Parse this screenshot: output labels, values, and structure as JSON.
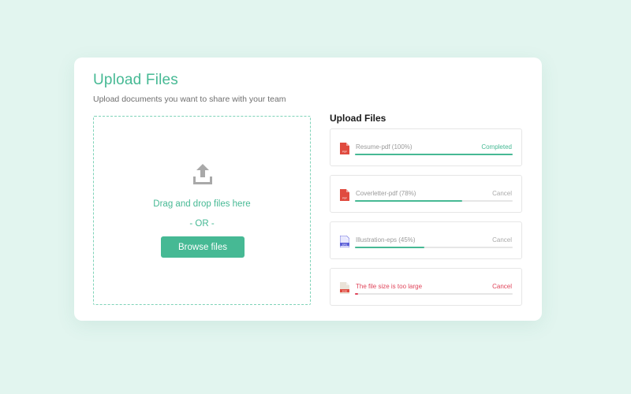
{
  "colors": {
    "accent": "#46b994",
    "error": "#e0445a",
    "background": "#e2f5ef"
  },
  "header": {
    "title": "Upload Files",
    "subtitle": "Upload documents you want to share with your team"
  },
  "dropzone": {
    "icon": "upload-icon",
    "drag_text": "Drag and drop files here",
    "or_text": "- OR -",
    "browse_label": "Browse files"
  },
  "panel": {
    "title": "Upload Files",
    "files": [
      {
        "name": "Resume-pdf (100%)",
        "action": "Completed",
        "progress": 1.0,
        "status": "done",
        "icon": "pdf-file-icon",
        "icon_label": "PDF",
        "icon_color": "#e04b3f"
      },
      {
        "name": "Coverletter-pdf (78%)",
        "action": "Cancel",
        "progress": 0.68,
        "status": "uploading",
        "icon": "pdf-file-icon",
        "icon_label": "PDF",
        "icon_color": "#e04b3f"
      },
      {
        "name": "Illustration-eps (45%)",
        "action": "Cancel",
        "progress": 0.44,
        "status": "uploading",
        "icon": "eps-file-icon",
        "icon_label": "EPS",
        "icon_color": "#5b5fd8"
      },
      {
        "name": "The file size is too large",
        "action": "Cancel",
        "progress": 0.02,
        "status": "error",
        "icon": "exe-file-icon",
        "icon_label": "EXE",
        "icon_color": "#e04b3f"
      }
    ]
  }
}
